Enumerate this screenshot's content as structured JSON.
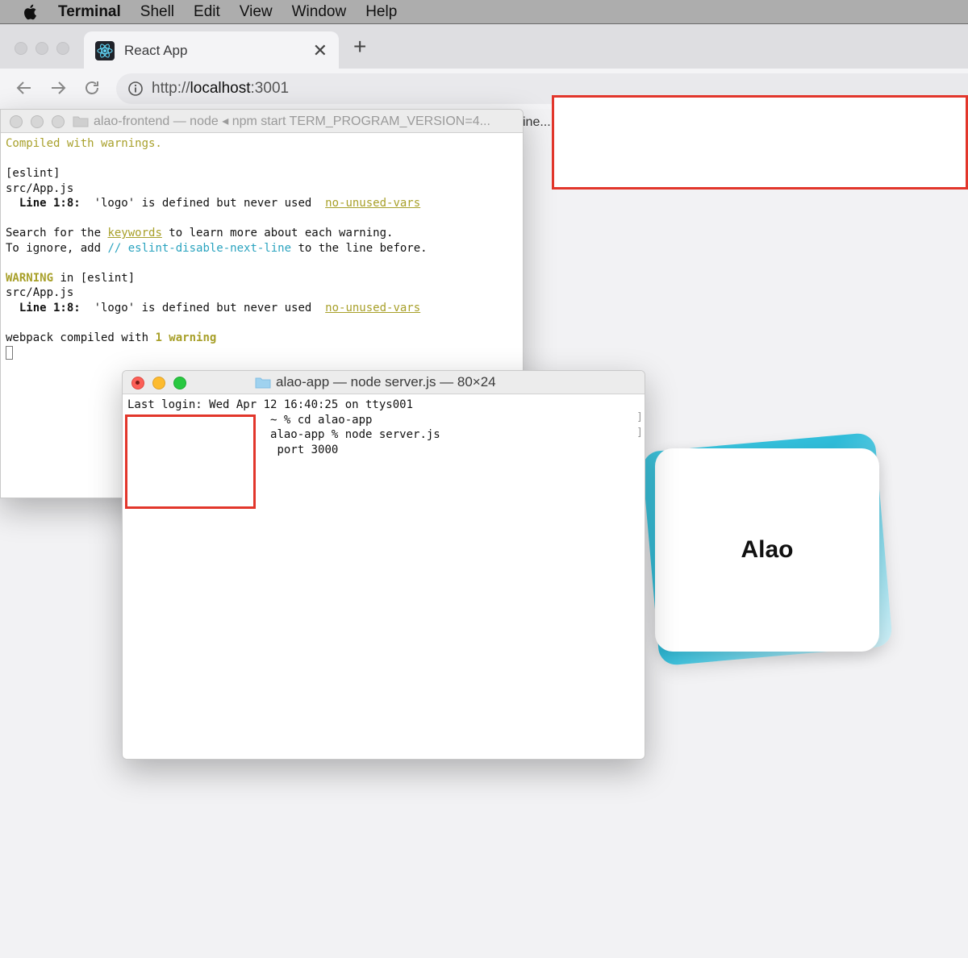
{
  "menubar": {
    "app_name": "Terminal",
    "items": [
      "Shell",
      "Edit",
      "View",
      "Window",
      "Help"
    ]
  },
  "browser": {
    "tab_title": "React App",
    "url_prefix": "http://",
    "url_host": "localhost",
    "url_port": ":3001",
    "truncated_right": "ine..."
  },
  "terminal_back": {
    "title": "alao-frontend — node ◂ npm start TERM_PROGRAM_VERSION=4...",
    "lines": {
      "compiled": "Compiled with warnings.",
      "eslint": "[eslint]",
      "file": "src/App.js",
      "line_label": "Line 1:8:",
      "warning_msg": "'logo' is defined but never used",
      "rule": "no-unused-vars",
      "search_pre": "Search for the ",
      "keywords": "keywords",
      "search_post": " to learn more about each warning.",
      "ignore_pre": "To ignore, add ",
      "ignore_comment": "// eslint-disable-next-line",
      "ignore_post": " to the line before.",
      "warning_word": "WARNING",
      "in_eslint": " in [eslint]",
      "webpack_pre": "webpack compiled with ",
      "webpack_warn": "1 warning"
    }
  },
  "terminal_front": {
    "title": "alao-app — node server.js — 80×24",
    "lines": {
      "last_login": "Last login: Wed Apr 12 16:40:25 on ttys001",
      "cmd1": "~ % cd alao-app",
      "cmd2": "alao-app % node server.js",
      "out1": "port 3000"
    }
  },
  "card": {
    "label": "Alao"
  },
  "colors": {
    "redaction_border": "#e2362b",
    "warning_yellow": "#a8a02a",
    "comment_cyan": "#2aa3bf",
    "card_gradient": "#3fc7e0"
  }
}
